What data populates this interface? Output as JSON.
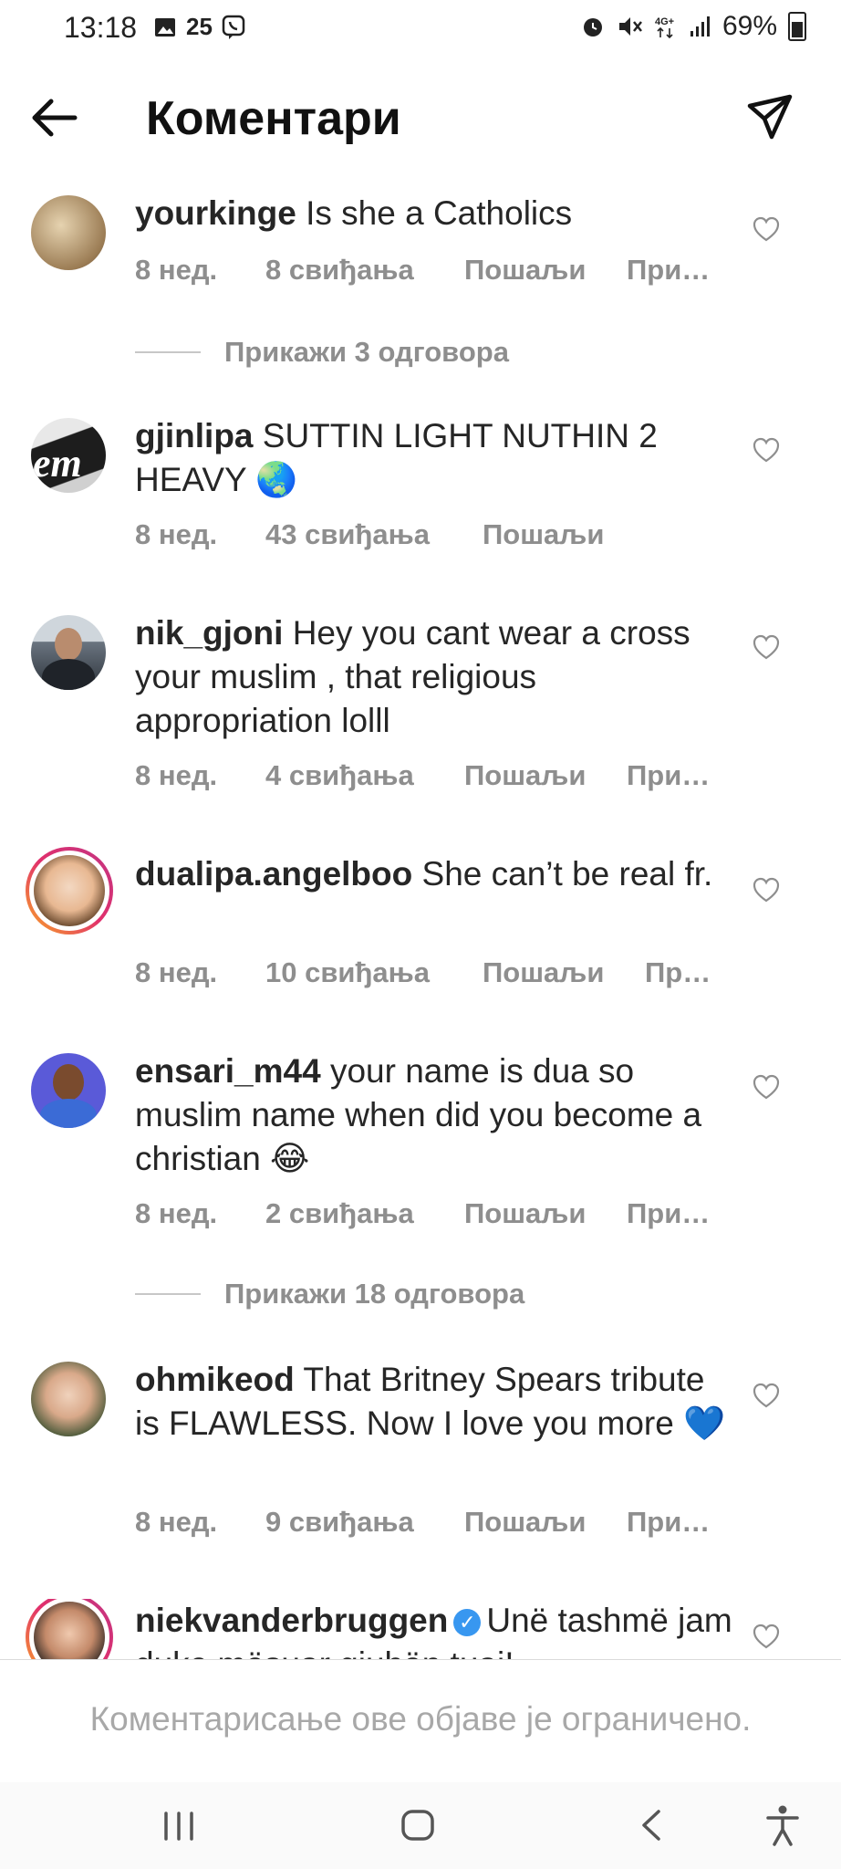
{
  "status_bar": {
    "time": "13:18",
    "left_icons": [
      "gallery-icon",
      "notification-25",
      "viber-icon"
    ],
    "notification_count": "25",
    "right_icons": [
      "alarm-icon",
      "mute-icon",
      "4g-icon",
      "signal-icon"
    ],
    "battery": "69%"
  },
  "header": {
    "title": "Коментари",
    "back_icon": "arrow-left-icon",
    "share_icon": "paper-plane-icon"
  },
  "comments": [
    {
      "username": "yourkinge",
      "text": "Is she a Catholics",
      "age": "8 нед.",
      "likes": "8 свиђања",
      "send": "Пошаљи",
      "more": "При…",
      "avatar_color": "#b9a07a"
    },
    {
      "username": "gjinlipa",
      "text": "SUTTIN LIGHT NUTHIN 2 HEAVY 🌏",
      "age": "8 нед.",
      "likes": "43 свиђања",
      "send": "Пошаљи",
      "avatar_color": "#2b2b2b"
    },
    {
      "username": "nik_gjoni",
      "text": "Hey you cant wear a cross your muslim , that religious appropriation lolll",
      "age": "8 нед.",
      "likes": "4 свиђања",
      "send": "Пошаљи",
      "more": "При…",
      "avatar_color": "#5a6470"
    },
    {
      "username": "dualipa.angelboo",
      "text": "She can’t be real fr.",
      "age": "8 нед.",
      "likes": "10 свиђања",
      "send": "Пошаљи",
      "more": "Пр…",
      "avatar_color": "#d8b08a"
    },
    {
      "username": "ensari_m44",
      "text": "your name is dua so muslim name when did you become a christian 😂",
      "age": "8 нед.",
      "likes": "2 свиђања",
      "send": "Пошаљи",
      "more": "При…",
      "avatar_color": "#5b5bd6"
    },
    {
      "username": "ohmikeod",
      "text": "That Britney Spears tribute is FLAWLESS. Now I love you more 💙",
      "age": "8 нед.",
      "likes": "9 свиђања",
      "send": "Пошаљи",
      "more": "При…",
      "avatar_color": "#6f8a5a"
    },
    {
      "username": "niekvanderbruggen",
      "text": "Unë tashmë jam duke mësuar gjuhën tuaj!",
      "verified": true,
      "avatar_color": "#c48a6a"
    }
  ],
  "reply_toggles": [
    {
      "label": "Прикажи 3 одговора"
    },
    {
      "label": "Прикажи 18 одговора"
    }
  ],
  "footer": {
    "restricted_message": "Коментарисање ове објаве је ограничено."
  },
  "nav_bar": {
    "icons": [
      "recents-icon",
      "home-icon",
      "back-icon",
      "accessibility-icon"
    ]
  }
}
